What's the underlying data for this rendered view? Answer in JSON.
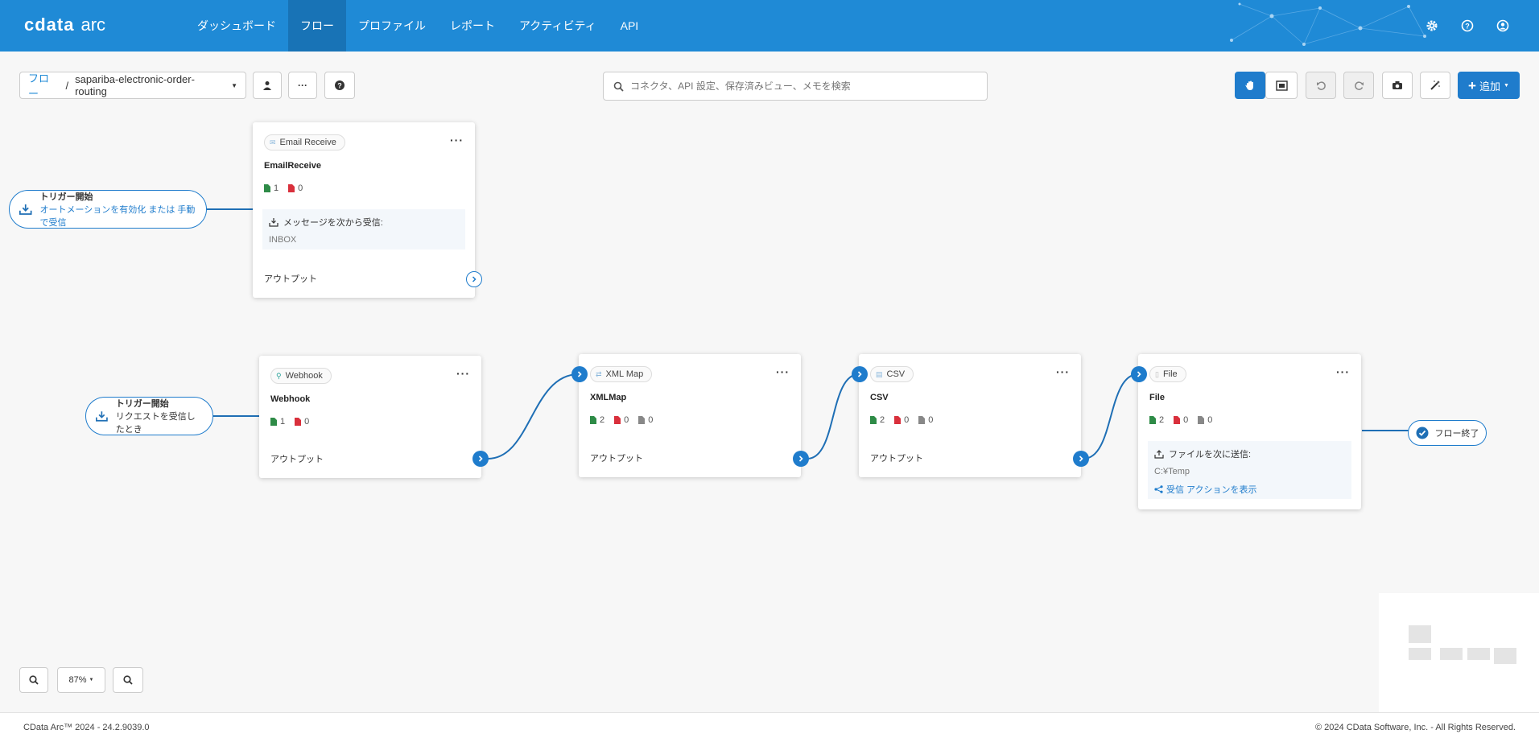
{
  "app": {
    "brand": "cdata",
    "product": "arc"
  },
  "nav": {
    "items": [
      {
        "label": "ダッシュボード",
        "active": false
      },
      {
        "label": "フロー",
        "active": true
      },
      {
        "label": "プロファイル",
        "active": false
      },
      {
        "label": "レポート",
        "active": false
      },
      {
        "label": "アクティビティ",
        "active": false
      },
      {
        "label": "API",
        "active": false
      }
    ],
    "icons": [
      "settings-icon",
      "help-icon",
      "user-icon"
    ]
  },
  "toolbar": {
    "breadcrumb_root": "フロー",
    "breadcrumb_sep": "/",
    "flow_name": "sapariba-electronic-order-routing",
    "search_placeholder": "コネクタ、API 設定、保存済みビュー、メモを検索",
    "add_label": "追加"
  },
  "triggers": [
    {
      "title": "トリガー開始",
      "subtitle": "オートメーションを有効化 または 手動で受信"
    },
    {
      "title": "トリガー開始",
      "subtitle": "リクエストを受信したとき"
    }
  ],
  "nodes": {
    "email": {
      "tag": "Email Receive",
      "name": "EmailReceive",
      "success": "1",
      "error": "0",
      "info_label": "メッセージを次から受信:",
      "info_value": "INBOX",
      "output": "アウトプット"
    },
    "webhook": {
      "tag": "Webhook",
      "name": "Webhook",
      "success": "1",
      "error": "0",
      "output": "アウトプット"
    },
    "xmlmap": {
      "tag": "XML Map",
      "name": "XMLMap",
      "success": "2",
      "error": "0",
      "pending": "0",
      "output": "アウトプット"
    },
    "csv": {
      "tag": "CSV",
      "name": "CSV",
      "success": "2",
      "error": "0",
      "pending": "0",
      "output": "アウトプット"
    },
    "file": {
      "tag": "File",
      "name": "File",
      "success": "2",
      "error": "0",
      "pending": "0",
      "info_label": "ファイルを次に送信:",
      "info_value": "C:¥Temp",
      "info_action": "受信 アクションを表示"
    }
  },
  "flow_end": "フロー終了",
  "zoom": {
    "level": "87%"
  },
  "footer": {
    "version": "CData Arc™ 2024 - 24.2.9039.0",
    "copyright": "© 2024 CData Software, Inc. - All Rights Reserved."
  },
  "colors": {
    "header": "#1f8ad6",
    "accent": "#1f7ccc",
    "success": "#2e8b47",
    "error": "#d9303c"
  }
}
